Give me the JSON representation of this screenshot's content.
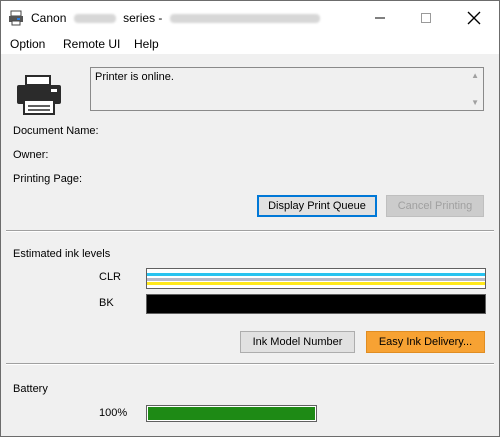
{
  "window": {
    "title_prefix": "Canon",
    "title_suffix": "series -",
    "controls": {
      "minimize": "—",
      "maximize": "☐",
      "close": "✕"
    }
  },
  "menu": [
    "Option",
    "Remote UI",
    "Help"
  ],
  "status": {
    "message": "Printer is online."
  },
  "job": {
    "document_name_label": "Document Name:",
    "owner_label": "Owner:",
    "printing_page_label": "Printing Page:"
  },
  "buttons": {
    "display_queue": "Display Print Queue",
    "cancel_printing": "Cancel Printing",
    "ink_model": "Ink Model Number",
    "easy_ink": "Easy Ink Delivery..."
  },
  "ink": {
    "section_label": "Estimated ink levels",
    "clr_label": "CLR",
    "bk_label": "BK",
    "colors": {
      "cyan": "#29c3ef",
      "magenta": "#b8b8c8",
      "yellow": "#ffe81a",
      "black": "#000000"
    }
  },
  "battery": {
    "section_label": "Battery",
    "percent_text": "100%",
    "level": 1.0,
    "fill_color": "#1e8a15"
  }
}
